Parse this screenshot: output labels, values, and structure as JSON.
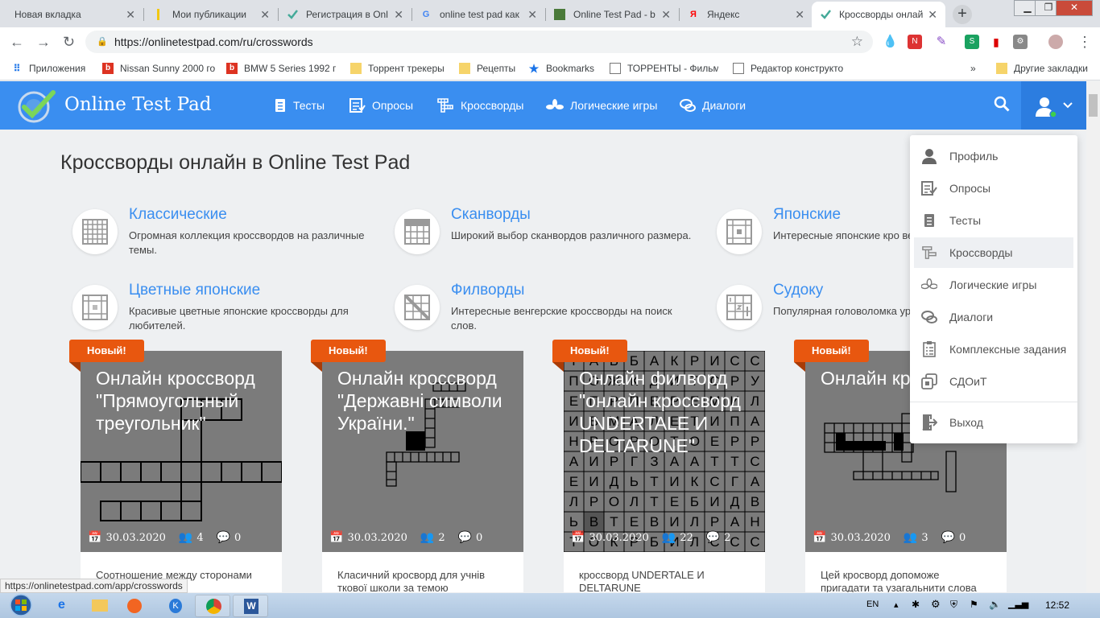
{
  "browser": {
    "tabs": [
      {
        "title": "Новая вкладка",
        "icon": "blank-icon"
      },
      {
        "title": "Мои публикации",
        "icon": "yandex-zen-icon"
      },
      {
        "title": "Регистрация в Onl",
        "icon": "onlinetestpad-icon"
      },
      {
        "title": "online test pad как",
        "icon": "google-icon"
      },
      {
        "title": "Online Test Pad - b",
        "icon": "image-icon"
      },
      {
        "title": "Яндекс",
        "icon": "yandex-icon"
      },
      {
        "title": "Кроссворды онлай",
        "icon": "onlinetestpad-icon"
      }
    ],
    "url": "https://onlinetestpad.com/ru/crosswords",
    "bookmarks": [
      {
        "label": "Приложения",
        "icon": "apps-icon"
      },
      {
        "label": "Nissan Sunny 2000 го",
        "icon": "b-icon"
      },
      {
        "label": "BMW 5 Series 1992 г",
        "icon": "b-icon"
      },
      {
        "label": "Торрент трекеры",
        "icon": "folder-icon"
      },
      {
        "label": "Рецепты",
        "icon": "folder-icon"
      },
      {
        "label": "Bookmarks",
        "icon": "star-icon"
      },
      {
        "label": "ТОРРЕНТЫ - Фильмь",
        "icon": "page-icon"
      },
      {
        "label": "Редактор конструкто",
        "icon": "page-icon"
      },
      {
        "label": "Другие закладки",
        "icon": "folder-icon"
      }
    ],
    "more_bookmarks": "»",
    "status_url": "https://onlinetestpad.com/app/crosswords"
  },
  "site": {
    "logo": "Online Test Pad",
    "nav": [
      {
        "label": "Тесты",
        "icon": "tests-icon"
      },
      {
        "label": "Опросы",
        "icon": "surveys-icon"
      },
      {
        "label": "Кроссворды",
        "icon": "crosswords-icon"
      },
      {
        "label": "Логические игры",
        "icon": "logic-games-icon"
      },
      {
        "label": "Диалоги",
        "icon": "dialogs-icon"
      }
    ],
    "page_title": "Кроссворды онлайн в Online Test Pad",
    "categories": [
      {
        "title": "Классические",
        "desc": "Огромная коллекция кроссвордов на различные темы."
      },
      {
        "title": "Сканворды",
        "desc": "Широкий выбор сканвордов различного размера."
      },
      {
        "title": "Японские",
        "desc": "Интересные японские кро велика."
      },
      {
        "title": "Цветные японские",
        "desc": "Красивые цветные японские кроссворды для любителей."
      },
      {
        "title": "Филворды",
        "desc": "Интересные венгерские кроссворды на поиск слов."
      },
      {
        "title": "Судоку",
        "desc": "Популярная головоломка уровня сложности."
      }
    ],
    "cards": [
      {
        "badge": "Новый!",
        "title": "Онлайн кроссворд \"Прямоугольный треугольник\"",
        "date": "30.03.2020",
        "users": "4",
        "comments": "0",
        "desc": "Соотношение между сторонами"
      },
      {
        "badge": "Новый!",
        "title": "Онлайн кроссворд \"Державні символи України.\"",
        "date": "30.03.2020",
        "users": "2",
        "comments": "0",
        "desc": "Класичний кросворд для учнів ткової школи за темою"
      },
      {
        "badge": "Новый!",
        "title": "Онлайн филворд \"онлайн кроссворд UNDERTALE И DELTARUNE\"",
        "date": "30.03.2020",
        "users": "22",
        "comments": "2",
        "desc": "кроссворд UNDERTALE И DELTARUNE"
      },
      {
        "badge": "Новый!",
        "title": "Онлайн кр \"Wir reiser",
        "date": "30.03.2020",
        "users": "3",
        "comments": "0",
        "desc": "Цей кросворд допоможе пригадати та узагальнити слова"
      }
    ],
    "fillword_rows": [
      "ТАЬБАКРИСС",
      "ПОЖКДИТСРУ",
      "ЕПРПЕРЕМИЛ",
      "ИВМАЛЕТИПА",
      "НРОРОТОЕРР",
      "АИРГЗААТТС",
      "ЕИДЬТИКСГА",
      "ЛРОЛТЕБИДВ",
      "ЬВТЕВИЛРАН",
      "ТОКРБИЛССС"
    ],
    "user_menu": [
      {
        "label": "Профиль",
        "icon": "profile-icon"
      },
      {
        "label": "Опросы",
        "icon": "surveys-icon"
      },
      {
        "label": "Тесты",
        "icon": "tests-icon"
      },
      {
        "label": "Кроссворды",
        "icon": "crosswords-icon",
        "selected": true
      },
      {
        "label": "Логические игры",
        "icon": "logic-games-icon"
      },
      {
        "label": "Диалоги",
        "icon": "dialogs-icon"
      },
      {
        "label": "Комплексные задания",
        "icon": "complex-tasks-icon"
      },
      {
        "label": "СДОиТ",
        "icon": "sdoit-icon"
      },
      {
        "label": "Выход",
        "icon": "logout-icon"
      }
    ]
  },
  "taskbar": {
    "lang": "EN",
    "time": "12:52"
  },
  "colors": {
    "header": "#3a8ef0",
    "badge": "#e8570f",
    "link": "#3a8ef0"
  }
}
